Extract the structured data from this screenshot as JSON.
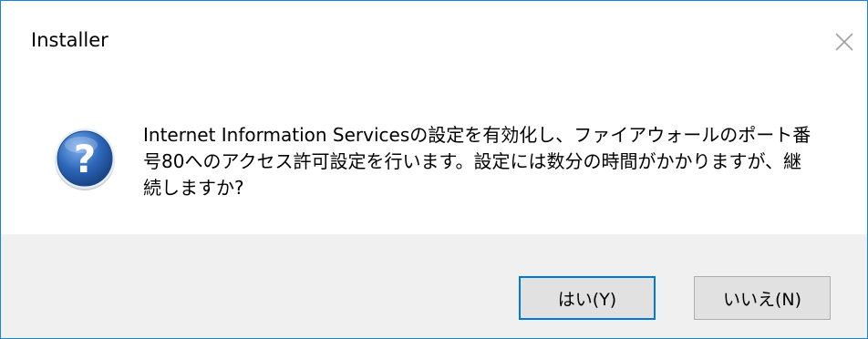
{
  "dialog": {
    "title": "Installer",
    "message": "Internet Information Servicesの設定を有効化し、ファイアウォールのポート番号80へのアクセス許可設定を行います。設定には数分の時間がかかりますが、継続しますか?",
    "icon": "question-icon",
    "yes_label": "はい(Y)",
    "no_label": "いいえ(N)",
    "colors": {
      "border": "#1883d7",
      "footer": "#f0f0f0",
      "button_face": "#e1e1e1",
      "focus": "#0078d7",
      "icon_blue": "#2d66b8"
    }
  }
}
